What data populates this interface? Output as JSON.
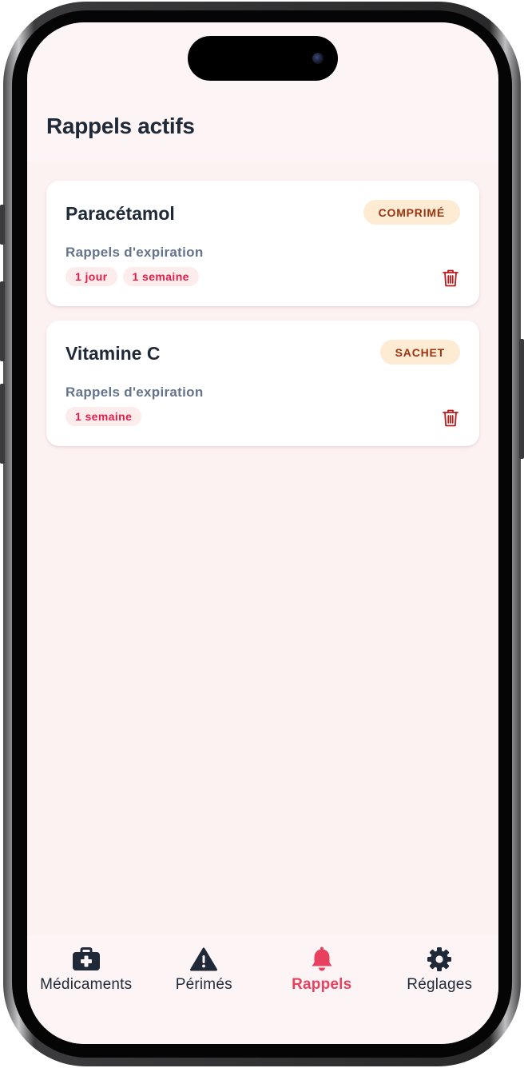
{
  "header": {
    "title": "Rappels actifs"
  },
  "reminders": [
    {
      "name": "Paracétamol",
      "form": "COMPRIMÉ",
      "label": "Rappels d'expiration",
      "chips": [
        "1 jour",
        "1 semaine"
      ]
    },
    {
      "name": "Vitamine C",
      "form": "SACHET",
      "label": "Rappels d'expiration",
      "chips": [
        "1 semaine"
      ]
    }
  ],
  "tabs": [
    {
      "label": "Médicaments",
      "icon": "medical-kit-icon",
      "active": false
    },
    {
      "label": "Périmés",
      "icon": "warning-icon",
      "active": false
    },
    {
      "label": "Rappels",
      "icon": "bell-icon",
      "active": true
    },
    {
      "label": "Réglages",
      "icon": "gear-icon",
      "active": false
    }
  ],
  "colors": {
    "accent": "#e8405f",
    "text": "#1f2937",
    "muted": "#64748b",
    "badge_bg": "#fdebd3",
    "badge_text": "#9a3412",
    "chip_bg": "#fdecec",
    "chip_text": "#e11d48",
    "trash": "#b91c1c",
    "background": "#fdf2f2"
  }
}
